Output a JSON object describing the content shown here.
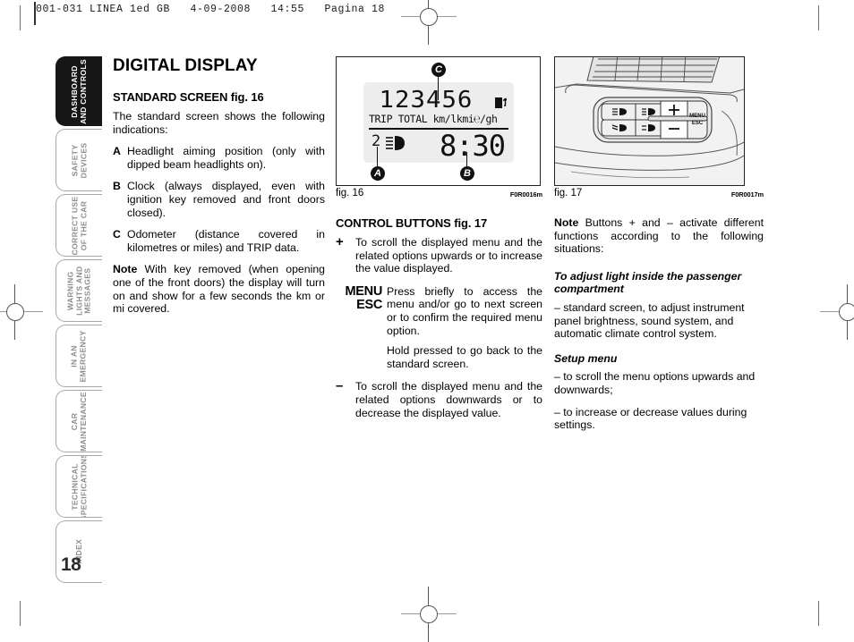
{
  "print_header": "001-031 LINEA 1ed GB   4-09-2008   14:55   Pagina 18",
  "page_number": "18",
  "sidebar": {
    "items": [
      {
        "label": "DASHBOARD\nAND CONTROLS",
        "active": true
      },
      {
        "label": "SAFETY\nDEVICES",
        "active": false
      },
      {
        "label": "CORRECT USE\nOF THE CAR",
        "active": false
      },
      {
        "label": "WARNING\nLIGHTS AND\nMESSAGES",
        "active": false
      },
      {
        "label": "IN AN\nEMERGENCY",
        "active": false
      },
      {
        "label": "CAR\nMAINTENANCE",
        "active": false
      },
      {
        "label": "TECHNICAL\nSPECIFICATIONS",
        "active": false
      },
      {
        "label": "INDEX",
        "active": false
      }
    ]
  },
  "col1": {
    "title": "DIGITAL DISPLAY",
    "section_title": "STANDARD SCREEN fig. 16",
    "intro": "The standard screen shows the following indications:",
    "items": [
      {
        "letter": "A",
        "text": "Headlight aiming position (only with dipped beam headlights on)."
      },
      {
        "letter": "B",
        "text": "Clock (always displayed, even with ignition key removed and front doors closed)."
      },
      {
        "letter": "C",
        "text": "Odometer (distance covered in kilometres or miles) and TRIP data."
      }
    ],
    "note_label": "Note",
    "note_text": " With key removed (when opening one of the front doors) the display will turn on and show for a few seconds the km or mi covered."
  },
  "fig16": {
    "caption": "fig. 16",
    "code": "F0R0016m",
    "lcd": {
      "odometer": "123456",
      "units": "TRIP TOTAL km/lkmi℮/gh",
      "headlight_level": "2",
      "clock": "8:30"
    },
    "callouts": [
      "A",
      "B",
      "C"
    ]
  },
  "fig17": {
    "caption": "fig. 17",
    "code": "F0R0017m",
    "buttons": {
      "plus": "+",
      "minus": "–",
      "menu_line1": "MENU",
      "menu_line2": "ESC"
    }
  },
  "col2": {
    "section_title": "CONTROL BUTTONS fig. 17",
    "entries": [
      {
        "symbol": "+",
        "symbol_class": "plus",
        "paragraphs": [
          "To scroll the displayed menu and the related options upwards or to increase the value displayed."
        ]
      },
      {
        "symbol": "MENU\nESC",
        "symbol_class": "menu",
        "paragraphs": [
          "Press briefly to access the menu and/or go to next screen or to confirm the required menu option.",
          "Hold pressed to go back to the standard screen."
        ]
      },
      {
        "symbol": "–",
        "symbol_class": "minus",
        "paragraphs": [
          "To scroll the displayed menu and the related options downwards or to decrease the displayed value."
        ]
      }
    ]
  },
  "col3": {
    "note_label": "Note",
    "note_text": " Buttons + and – activate different functions according to the following situations:",
    "sub1_title": "To adjust light inside the passenger compartment",
    "sub1_text": "– standard screen, to adjust instrument panel brightness, sound system, and automatic climate control system.",
    "sub2_title": "Setup menu",
    "sub2_text1": "– to scroll the menu options upwards and downwards;",
    "sub2_text2": "– to increase or decrease values during settings."
  }
}
